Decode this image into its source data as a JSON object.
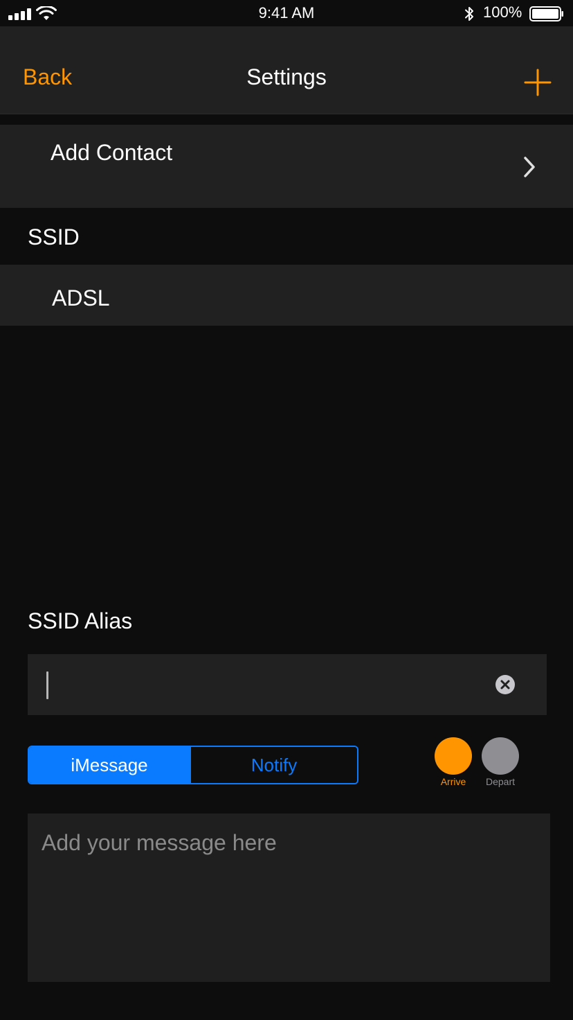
{
  "status_bar": {
    "time": "9:41 AM",
    "battery_percent": "100%",
    "icons": [
      "cellular-signal-icon",
      "wifi-icon",
      "bluetooth-icon",
      "battery-icon"
    ]
  },
  "nav": {
    "back_label": "Back",
    "title": "Settings",
    "add_icon": "plus-icon"
  },
  "rows": {
    "add_contact": "Add Contact",
    "ssid_header": "SSID",
    "ssid_value": "ADSL",
    "alias_header": "SSID Alias"
  },
  "alias_input": {
    "value": "",
    "placeholder": ""
  },
  "segmented": {
    "options": [
      "iMessage",
      "Notify"
    ],
    "selected": "iMessage"
  },
  "trigger": {
    "arrive_label": "Arrive",
    "depart_label": "Depart",
    "selected": "Arrive"
  },
  "message": {
    "placeholder": "Add your message here",
    "value": ""
  },
  "colors": {
    "accent_orange": "#ff9500",
    "accent_blue": "#0a7aff",
    "row_background": "#212121",
    "background": "#0d0d0d",
    "inactive_gray": "#8e8e93"
  }
}
